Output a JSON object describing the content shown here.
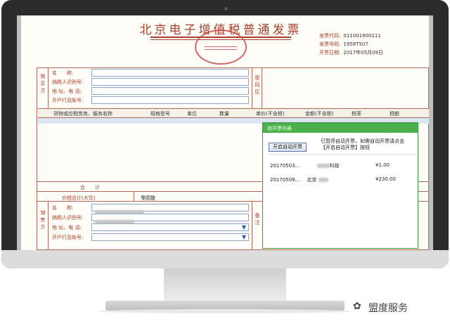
{
  "invoice": {
    "title": "北京电子增值税普通发票",
    "meta": [
      {
        "label": "发票代码:",
        "value": "011001600111"
      },
      {
        "label": "发票号码:",
        "value": "1958T507"
      },
      {
        "label": "开票日期:",
        "value": "2017年05月09日"
      }
    ]
  },
  "buyer": {
    "section_label": "购买方",
    "fields": [
      {
        "label": "名　　称:"
      },
      {
        "label": "纳税人识别号:"
      },
      {
        "label": "地 址、电 话:"
      },
      {
        "label": "开户行及账号:"
      }
    ],
    "password_label": "密码区"
  },
  "table": {
    "headers": [
      "货物或应税劳务、服务名称",
      "规格型号",
      "单位",
      "数量",
      "单价(不含税)",
      "金额(不含税)",
      "税率",
      "税额"
    ]
  },
  "totals": {
    "sum_label": "合　　计",
    "tax_total_label": "价税合计(大写)",
    "tax_total_value": "零圆整"
  },
  "seller": {
    "section_label": "销售方",
    "fields": [
      {
        "label": "名　　称:"
      },
      {
        "label": "纳税人识别号:"
      },
      {
        "label": "地 址、电 话:"
      },
      {
        "label": "开户行及账号:"
      }
    ],
    "remark_label": "备注"
  },
  "popup": {
    "title": "待开票列表",
    "button": "开启自动开票",
    "note": "已暂停自动开票，如需自动开票请点击【开启自动开票】按钮",
    "rows": [
      {
        "date": "20170503...",
        "name": "科技",
        "amount": "¥1.00"
      },
      {
        "date": "20170509...",
        "name": "北京",
        "amount": "¥230.00"
      }
    ]
  },
  "watermark": {
    "text": "盟度服务",
    "icon": "wechat-icon"
  },
  "colors": {
    "invoice_accent": "#a5402a",
    "popup_header": "#4bb04b"
  }
}
